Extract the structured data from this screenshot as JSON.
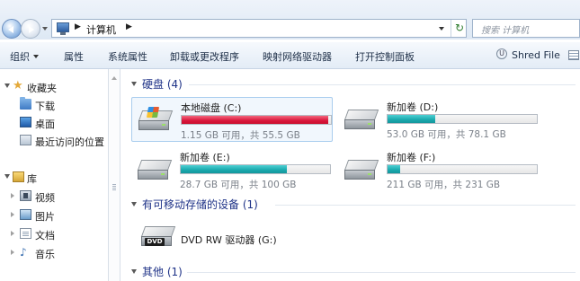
{
  "address": {
    "crumbs": [
      "计算机"
    ],
    "search_placeholder": "搜索 计算机"
  },
  "toolbar": {
    "organize": "组织",
    "properties": "属性",
    "system_properties": "系统属性",
    "uninstall": "卸载或更改程序",
    "map_drive": "映射网络驱动器",
    "control_panel": "打开控制面板",
    "shred": "Shred File"
  },
  "nav": {
    "favorites": "收藏夹",
    "downloads": "下载",
    "desktop": "桌面",
    "recent": "最近访问的位置",
    "libraries": "库",
    "video": "视频",
    "pictures": "图片",
    "documents": "文档",
    "music": "音乐"
  },
  "groups": {
    "hard_disks": "硬盘 (4)",
    "removable": "有可移动存储的设备 (1)",
    "other": "其他 (1)"
  },
  "drives": [
    {
      "name": "本地磁盘 (C:)",
      "space": "1.15 GB 可用，共 55.5 GB",
      "used_fraction": 0.979,
      "color": "#d9163b"
    },
    {
      "name": "新加卷 (D:)",
      "space": "53.0 GB 可用，共 78.1 GB",
      "used_fraction": 0.32,
      "color": "#1aa8ad"
    },
    {
      "name": "新加卷 (E:)",
      "space": "28.7 GB 可用，共 100 GB",
      "used_fraction": 0.713,
      "color": "#1aa8ad"
    },
    {
      "name": "新加卷 (F:)",
      "space": "211 GB 可用，共 231 GB",
      "used_fraction": 0.087,
      "color": "#1aa8ad"
    }
  ],
  "dvd": {
    "name": "DVD RW 驱动器 (G:)",
    "badge": "DVD"
  }
}
